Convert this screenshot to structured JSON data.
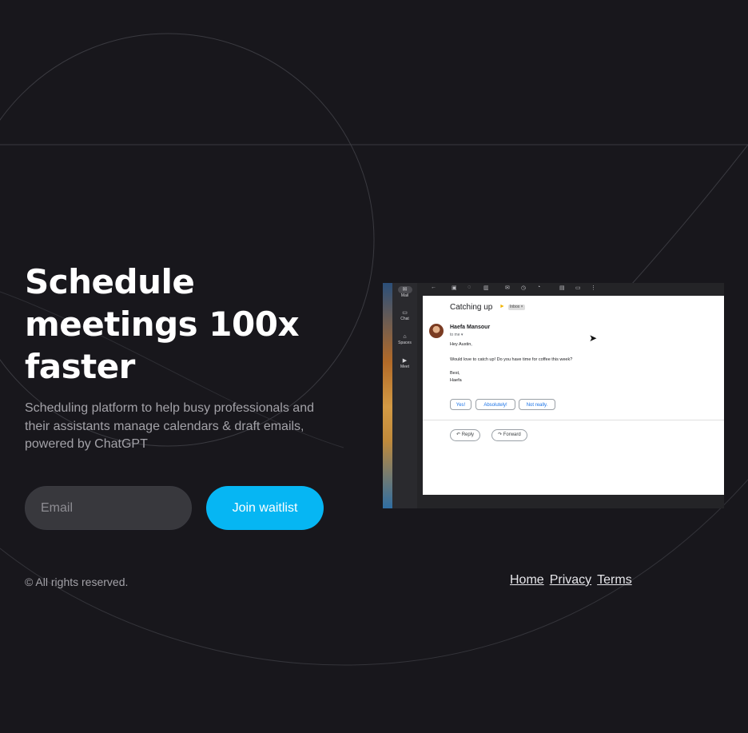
{
  "hero": {
    "headline_line1": "Schedule",
    "headline_line2": "meetings 100x",
    "headline_line3": "faster",
    "subtext": "Scheduling platform to help busy professionals and their assistants manage calendars & draft emails, powered by ChatGPT"
  },
  "form": {
    "email_placeholder": "Email",
    "join_label": "Join waitlist"
  },
  "footer": {
    "copyright": "© All rights reserved.",
    "links": [
      "Home",
      "Privacy",
      "Terms"
    ]
  },
  "preview": {
    "rail": [
      {
        "icon": "mail-icon",
        "label": "Mail"
      },
      {
        "icon": "chat-icon",
        "label": "Chat"
      },
      {
        "icon": "spaces-icon",
        "label": "Spaces"
      },
      {
        "icon": "meet-icon",
        "label": "Meet"
      }
    ],
    "subject": "Catching up",
    "inbox_chip": "Inbox ×",
    "sender": "Haefa Mansour",
    "to_me": "to me ▾",
    "greeting": "Hey Austin,",
    "body": "Would love to catch up! Do you have time for coffee this week?",
    "signoff": "Best,",
    "signature": "Haefa",
    "smart_replies": [
      "Yes!",
      "Absolutely!",
      "Not really."
    ],
    "reply_label": "Reply",
    "forward_label": "Forward"
  },
  "colors": {
    "background": "#18171c",
    "accent": "#06b6f3",
    "input_bg": "#38383d",
    "muted_text": "#a3a2a8"
  }
}
